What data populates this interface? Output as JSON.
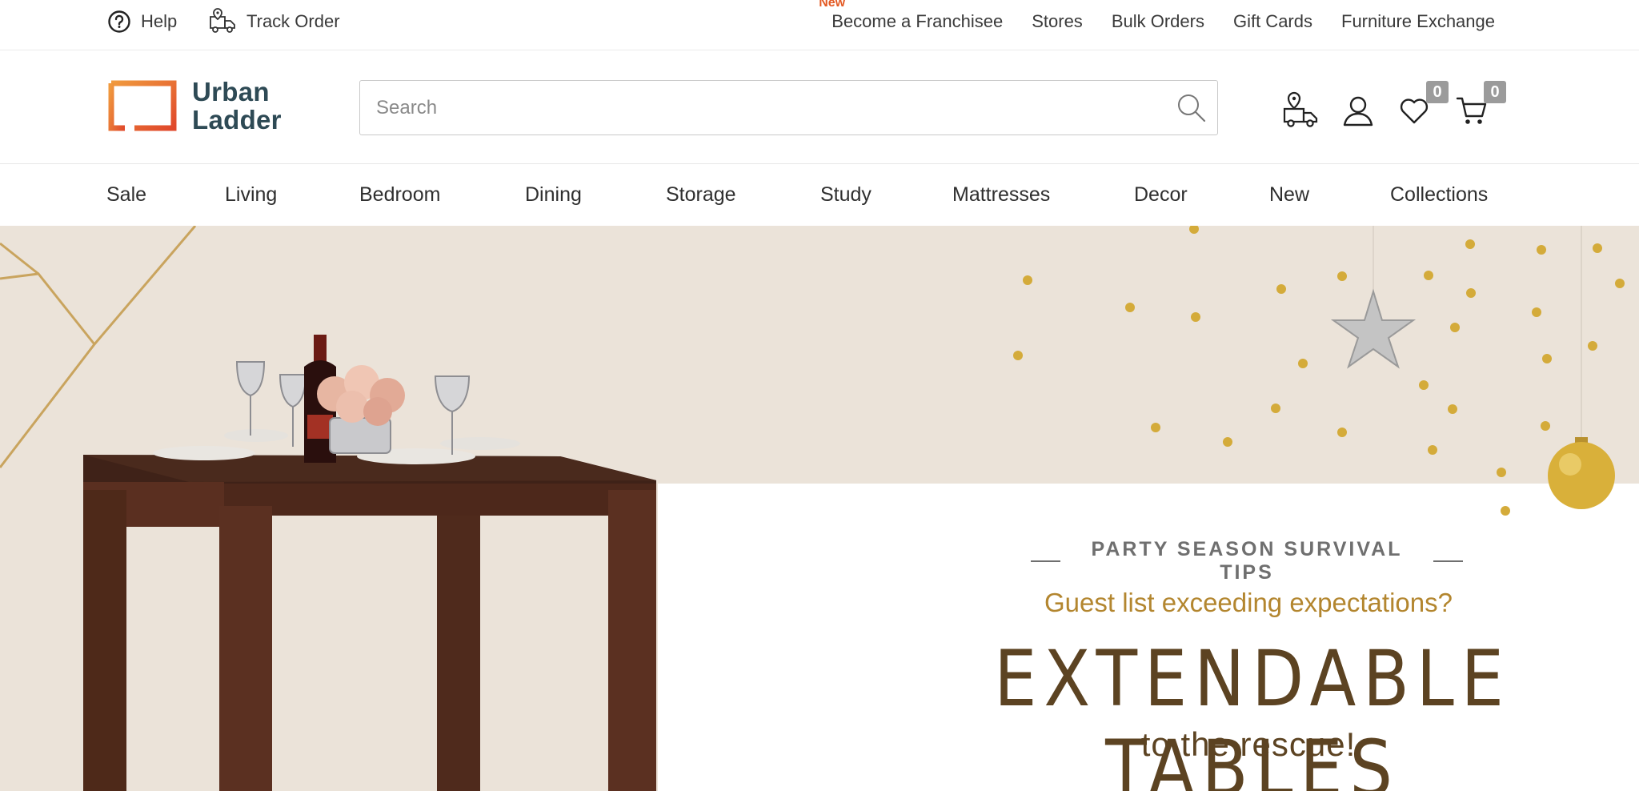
{
  "topbar": {
    "help_label": "Help",
    "track_label": "Track Order",
    "new_tag": "New",
    "links": [
      "Become a Franchisee",
      "Stores",
      "Bulk Orders",
      "Gift Cards",
      "Furniture Exchange"
    ]
  },
  "header": {
    "logo_line1": "Urban",
    "logo_line2": "Ladder",
    "search_placeholder": "Search",
    "wishlist_count": "0",
    "cart_count": "0"
  },
  "categories": [
    "Sale",
    "Living",
    "Bedroom",
    "Dining",
    "Storage",
    "Study",
    "Mattresses",
    "Decor",
    "New",
    "Collections"
  ],
  "hero": {
    "eyebrow": "PARTY SEASON SURVIVAL TIPS",
    "subtitle": "Guest list exceeding expectations?",
    "title": "EXTENDABLE TABLES",
    "tagline": "to the rescue!"
  },
  "colors": {
    "brand_orange": "#e8742c",
    "brand_text": "#2e4a55",
    "hero_bg": "#ebe3d9",
    "hero_gold": "#b3862f",
    "hero_brown": "#5c4322",
    "badge_grey": "#9b9b9b"
  },
  "icons": {
    "help": "question-circle-icon",
    "track": "delivery-truck-pin-icon",
    "search": "magnifier-icon",
    "store": "store-locator-icon",
    "account": "user-icon",
    "wishlist": "heart-icon",
    "cart": "cart-icon"
  }
}
